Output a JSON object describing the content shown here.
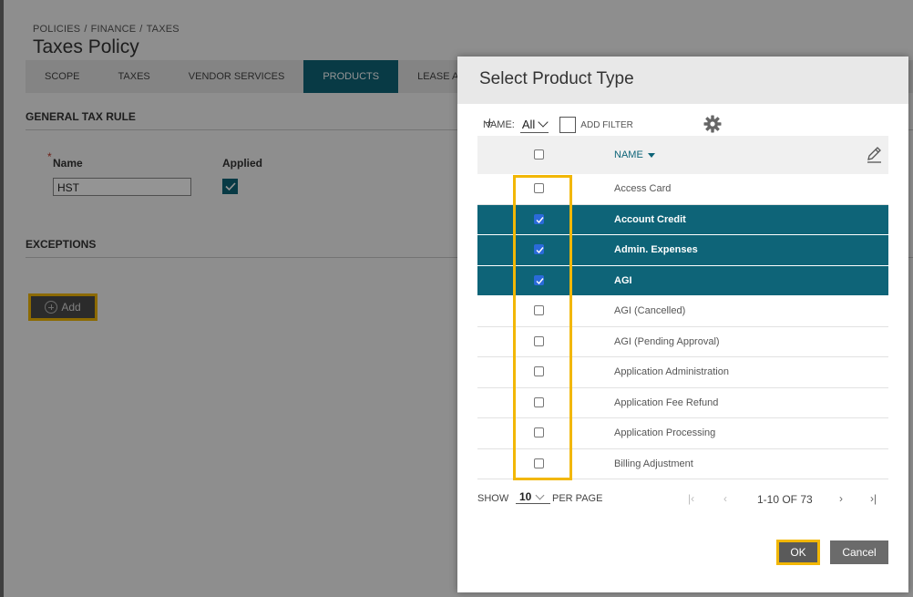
{
  "breadcrumb": [
    "POLICIES",
    "FINANCE",
    "TAXES"
  ],
  "page_title": "Taxes Policy",
  "tabs": [
    {
      "label": "SCOPE",
      "active": false
    },
    {
      "label": "TAXES",
      "active": false
    },
    {
      "label": "VENDOR SERVICES",
      "active": false
    },
    {
      "label": "PRODUCTS",
      "active": true
    },
    {
      "label": "LEASE ADJ",
      "active": false
    }
  ],
  "general_tax_rule": {
    "title": "GENERAL TAX RULE",
    "name_label": "Name",
    "name_value": "HST",
    "applied_label": "Applied",
    "applied": true
  },
  "exceptions": {
    "title": "EXCEPTIONS",
    "add_label": "Add"
  },
  "modal": {
    "title": "Select Product Type",
    "filter": {
      "name_label": "NAME:",
      "name_value": "All",
      "add_filter_label": "ADD FILTER"
    },
    "column_name": "NAME",
    "rows": [
      {
        "label": "Access Card",
        "checked": false
      },
      {
        "label": "Account Credit",
        "checked": true
      },
      {
        "label": "Admin. Expenses",
        "checked": true
      },
      {
        "label": "AGI",
        "checked": true
      },
      {
        "label": "AGI (Cancelled)",
        "checked": false
      },
      {
        "label": "AGI (Pending Approval)",
        "checked": false
      },
      {
        "label": "Application Administration",
        "checked": false
      },
      {
        "label": "Application Fee Refund",
        "checked": false
      },
      {
        "label": "Application Processing",
        "checked": false
      },
      {
        "label": "Billing Adjustment",
        "checked": false
      }
    ],
    "pager": {
      "show_label": "SHOW",
      "per_page_value": "10",
      "per_page_label": "PER PAGE",
      "range": "1-10 OF 73",
      "first": "|‹",
      "prev": "‹",
      "next": "›",
      "last": "›|"
    },
    "ok_label": "OK",
    "cancel_label": "Cancel"
  },
  "colors": {
    "accent": "#0e6478",
    "highlight": "#f2b705",
    "checkbox": "#2a6ad9"
  }
}
